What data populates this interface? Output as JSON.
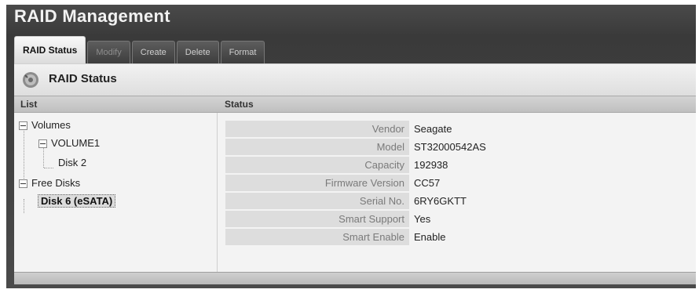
{
  "window": {
    "title": "RAID Management"
  },
  "tabs": [
    {
      "label": "RAID Status",
      "state": "active"
    },
    {
      "label": "Modify",
      "state": "disabled"
    },
    {
      "label": "Create",
      "state": "normal"
    },
    {
      "label": "Delete",
      "state": "normal"
    },
    {
      "label": "Format",
      "state": "normal"
    }
  ],
  "panel": {
    "title": "RAID Status",
    "title_icon": "gear-disk-icon",
    "list_header": "List",
    "status_header": "Status"
  },
  "tree": {
    "volumes": "Volumes",
    "volume1": "VOLUME1",
    "disk2": "Disk 2",
    "free_disks": "Free Disks",
    "disk6": "Disk 6 (eSATA)",
    "selected": "Disk 6 (eSATA)"
  },
  "status": [
    {
      "label": "Vendor",
      "value": "Seagate"
    },
    {
      "label": "Model",
      "value": "ST32000542AS"
    },
    {
      "label": "Capacity",
      "value": "192938"
    },
    {
      "label": "Firmware Version",
      "value": "CC57"
    },
    {
      "label": "Serial No.",
      "value": "6RY6GKTT"
    },
    {
      "label": "Smart Support",
      "value": "Yes"
    },
    {
      "label": "Smart Enable",
      "value": "Enable"
    }
  ]
}
